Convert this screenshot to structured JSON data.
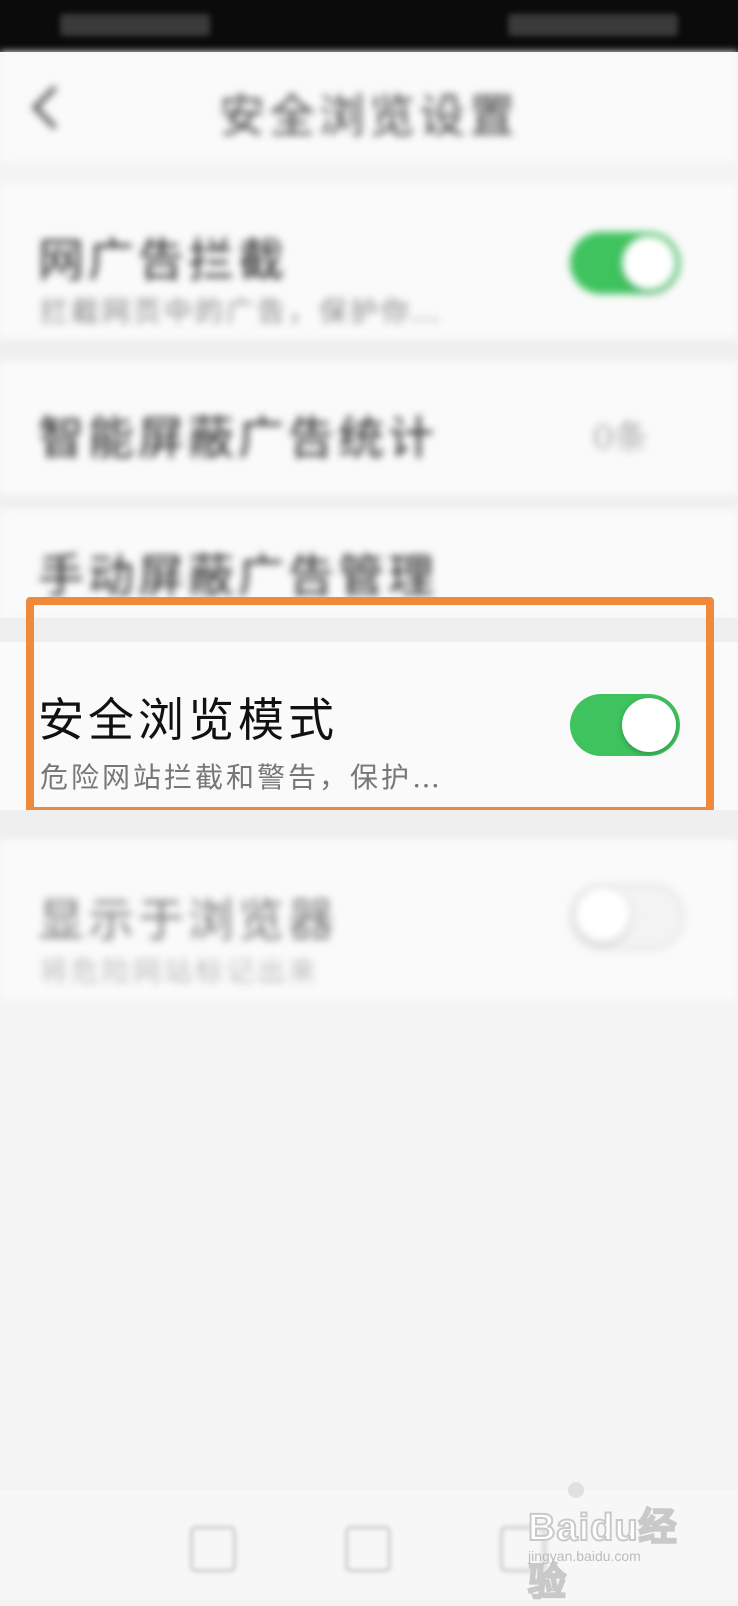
{
  "header": {
    "title": "安全浏览设置"
  },
  "rows": {
    "ad_block": {
      "title": "网广告拦截",
      "subtitle": "拦截网页中的广告，保护你…",
      "toggle_on": true
    },
    "smart_block": {
      "title": "智能屏蔽广告统计",
      "value": "0条"
    },
    "manual_block": {
      "title": "手动屏蔽广告管理"
    },
    "safe_browsing": {
      "title": "安全浏览模式",
      "subtitle": "危险网站拦截和警告，保护…",
      "toggle_on": true
    },
    "obscured": {
      "title": "显示于浏览器",
      "subtitle": "将危险网站标记出来",
      "toggle_on": false
    }
  },
  "watermark": {
    "text": "Baidu经验",
    "url": "jingyan.baidu.com"
  },
  "colors": {
    "toggle_on": "#3ec35f",
    "highlight_border": "#f08a3a"
  }
}
